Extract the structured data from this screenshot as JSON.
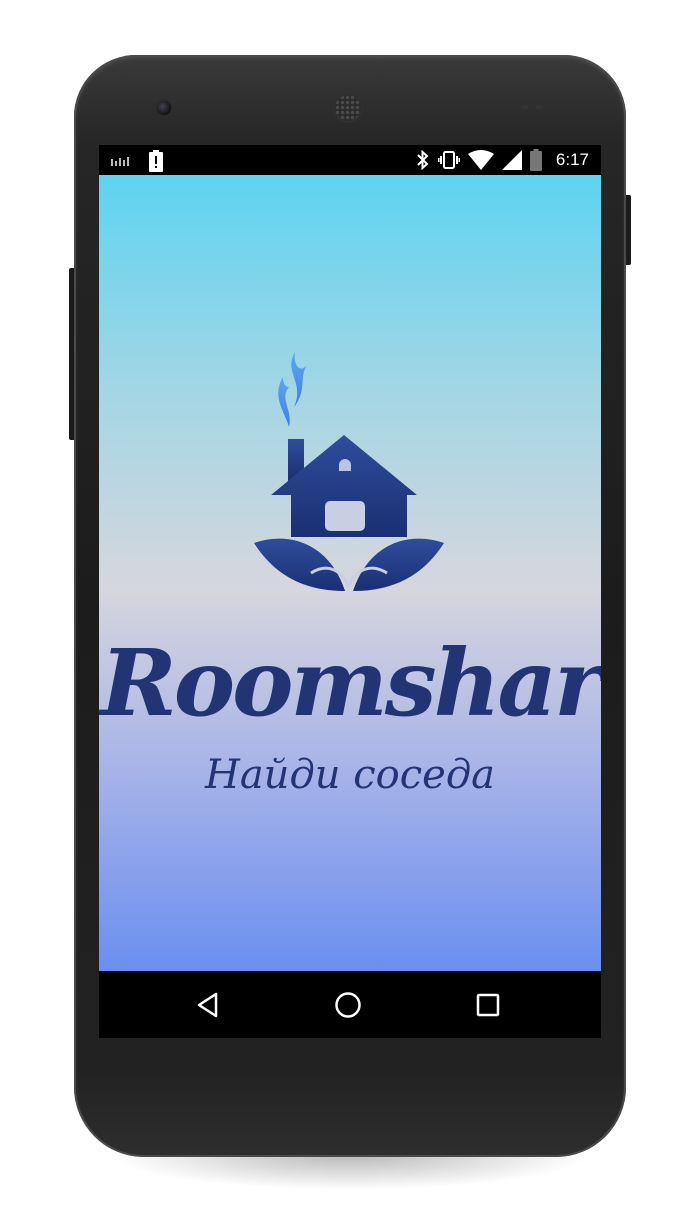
{
  "status_bar": {
    "time": "6:17",
    "left_icons": [
      "signal-bars-icon",
      "battery-alert-icon"
    ],
    "right_icons": [
      "bluetooth-icon",
      "vibrate-icon",
      "wifi-icon",
      "cell-signal-icon",
      "battery-icon"
    ]
  },
  "app": {
    "brand": "Roomshar",
    "tagline": "Найди соседа",
    "logo": "house-with-leaves-logo",
    "colors": {
      "gradient_top": "#5ed3f1",
      "gradient_mid": "#d6d6de",
      "gradient_bottom": "#6a8ff0",
      "brand": "#223474"
    }
  },
  "nav_bar": {
    "buttons": [
      "back-icon",
      "home-icon",
      "recent-apps-icon"
    ]
  }
}
